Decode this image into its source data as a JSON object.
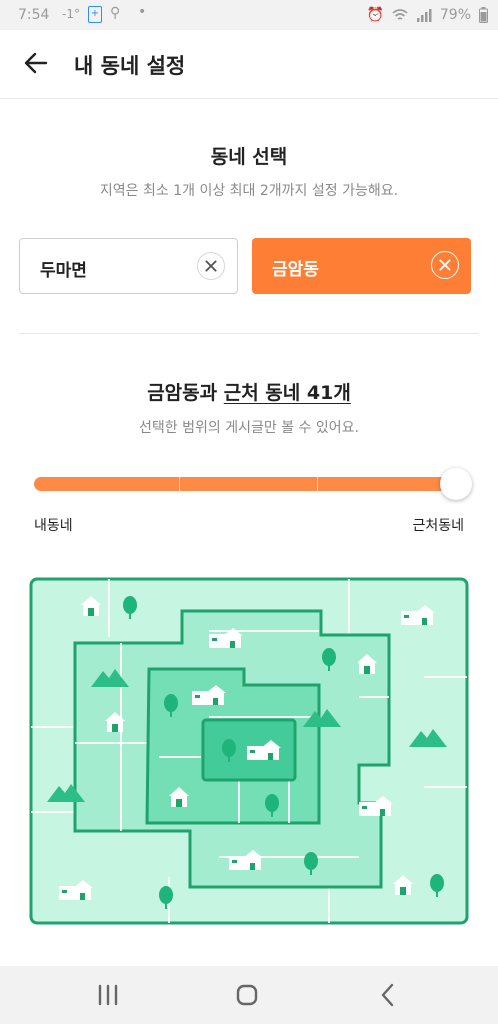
{
  "status_bar": {
    "time": "7:54",
    "notif_text": "-1°",
    "battery": "79%"
  },
  "header": {
    "title": "내 동네 설정"
  },
  "section_select": {
    "title": "동네 선택",
    "subtitle": "지역은 최소 1개 이상 최대 2개까지 설정 가능해요."
  },
  "neighborhoods": [
    {
      "name": "두마면",
      "selected": false
    },
    {
      "name": "금암동",
      "selected": true
    }
  ],
  "range": {
    "title_prefix": "금암동과 ",
    "title_link": "근처 동네 41개",
    "subtitle": "선택한 범위의 게시글만 볼 수 있어요.",
    "min_label": "내동네",
    "max_label": "근처동네",
    "level": 4,
    "max_level": 4
  },
  "colors": {
    "accent": "#ff7e36",
    "map_border": "#1fa36d",
    "map_light": "#c6f5e2",
    "map_mid": "#8fe5c2",
    "map_dark": "#4cd1a0"
  },
  "nav": {
    "recents": "recents-icon",
    "home": "home-icon",
    "back": "back-icon"
  }
}
